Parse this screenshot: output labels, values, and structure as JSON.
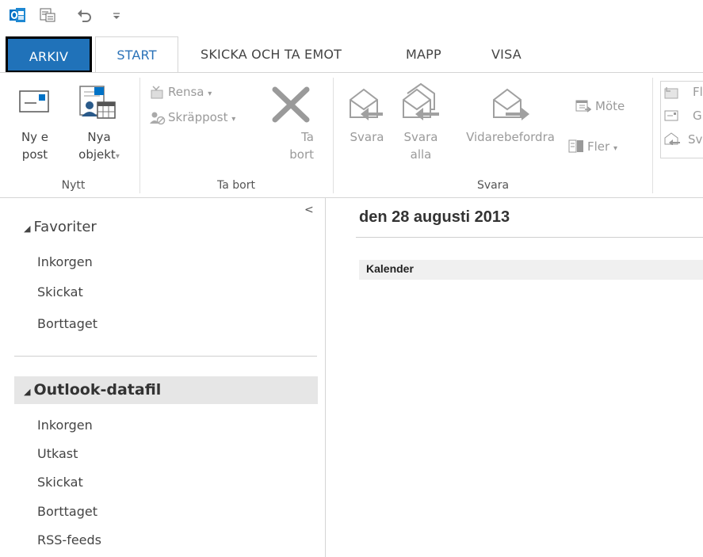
{
  "tabs": {
    "arkiv": "ARKIV",
    "start": "START",
    "skicka": "SKICKA OCH TA EMOT",
    "mapp": "MAPP",
    "visa": "VISA"
  },
  "ribbon": {
    "nytt": {
      "group_label": "Nytt",
      "ny_epost_line1": "Ny e",
      "ny_epost_line2": "post",
      "nya_objekt_line1": "Nya",
      "nya_objekt_line2": "objekt",
      "nya_objekt_arrow": "▾"
    },
    "ta_bort": {
      "group_label": "Ta bort",
      "rensa": "Rensa",
      "skrappost": "Skräppost",
      "dropdown_arrow": "▾",
      "ta_bort_line1": "Ta",
      "ta_bort_line2": "bort"
    },
    "svara": {
      "group_label": "Svara",
      "svara": "Svara",
      "svara_alla_line1": "Svara",
      "svara_alla_line2": "alla",
      "vidarebefordra": "Vidarebefordra",
      "mote": "Möte",
      "fler": "Fler",
      "dropdown_arrow": "▾"
    },
    "snabbsteg": {
      "item1": "Fl",
      "item2": "G",
      "item3": "Sv"
    }
  },
  "nav": {
    "collapse_glyph": "<",
    "favorites_header": "Favoriter",
    "collapse_triangle": "◢",
    "favorites": [
      "Inkorgen",
      "Skickat",
      "Borttaget"
    ],
    "datafile_header": "Outlook-datafil",
    "datafile_items": [
      "Inkorgen",
      "Utkast",
      "Skickat",
      "Borttaget",
      "RSS-feeds"
    ]
  },
  "main": {
    "date_heading": "den 28 augusti 2013",
    "calendar_label": "Kalender"
  },
  "colors": {
    "accent": "#2072b9",
    "outlook_blue": "#0072c6",
    "disabled": "#9a9a9a"
  }
}
